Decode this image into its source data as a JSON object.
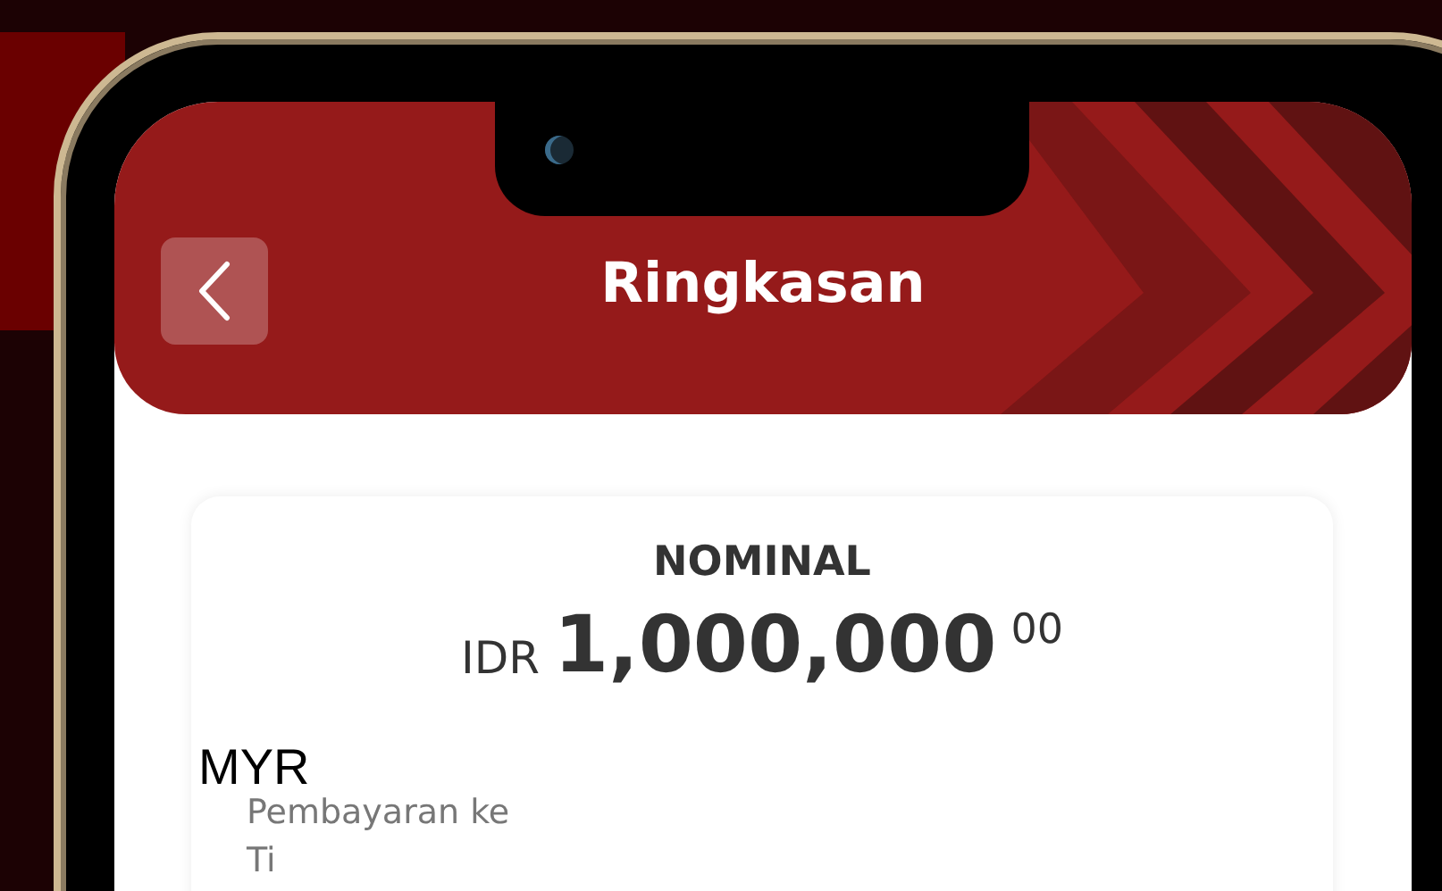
{
  "header": {
    "title": "Ringkasan"
  },
  "nominal": {
    "label": "NOMINAL",
    "currency": "IDR",
    "amount": "1,000,000",
    "decimals": "00"
  },
  "overlay_label": "MYR",
  "details": [
    {
      "label": "Pembayaran ke"
    },
    {
      "label": "Ti"
    }
  ]
}
